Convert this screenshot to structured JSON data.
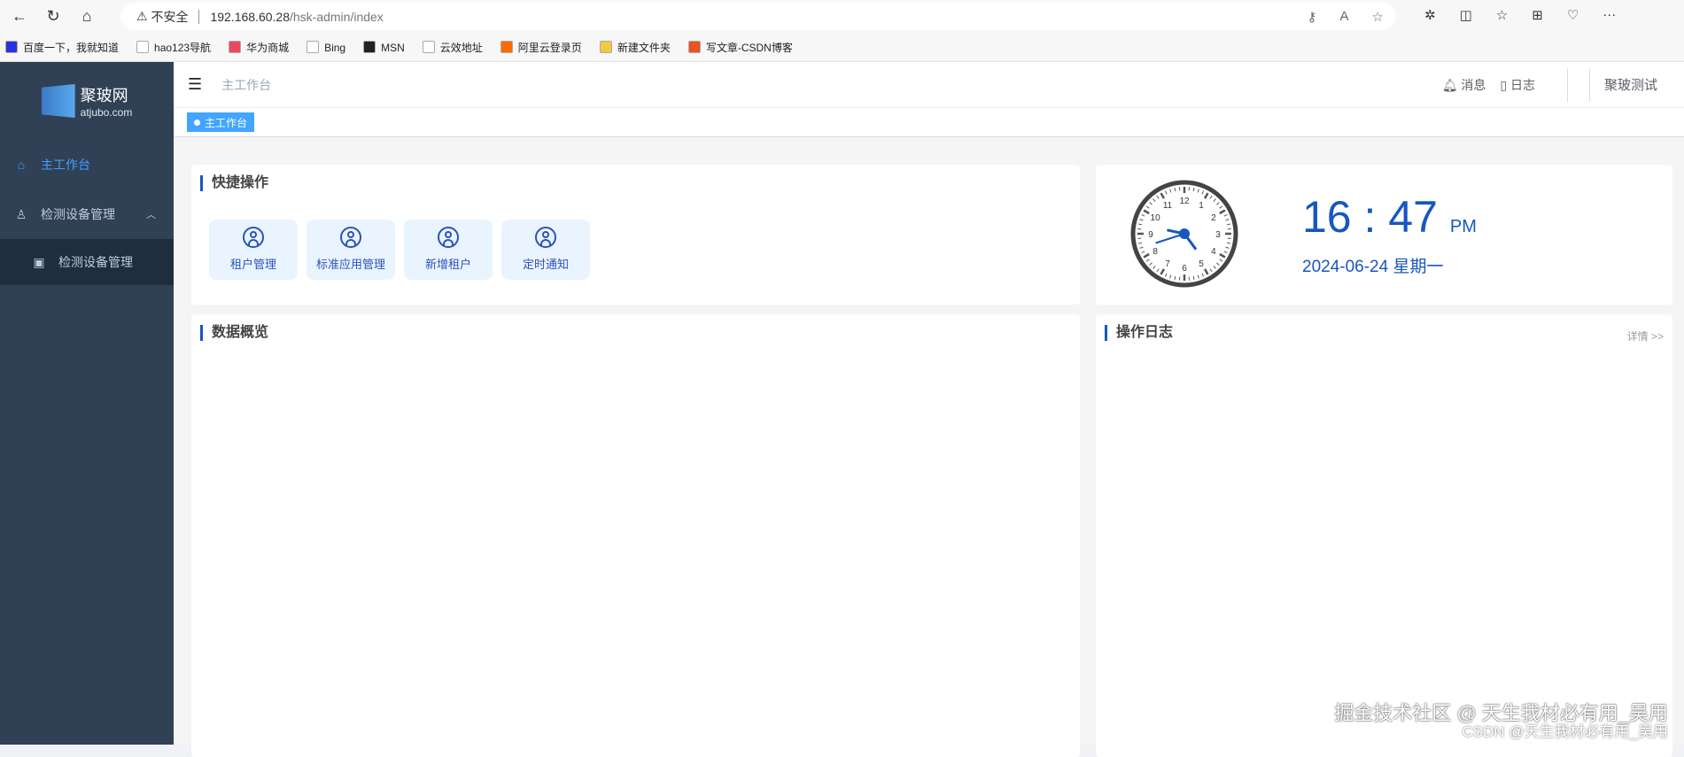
{
  "browser": {
    "security": "不安全",
    "url_host": "192.168.60.28",
    "url_path": "/hsk-admin/index"
  },
  "bookmarks": [
    {
      "label": "百度一下，我就知道",
      "color": "#2932e1"
    },
    {
      "label": "hao123导航",
      "color": "#ffffff"
    },
    {
      "label": "华为商城",
      "color": "#e84a5f"
    },
    {
      "label": "Bing",
      "color": "#ffffff"
    },
    {
      "label": "MSN",
      "color": "#222222"
    },
    {
      "label": "云效地址",
      "color": "#ffffff"
    },
    {
      "label": "阿里云登录页",
      "color": "#ff6a00"
    },
    {
      "label": "新建文件夹",
      "color": "#f5c842"
    },
    {
      "label": "写文章-CSDN博客",
      "color": "#e9541f"
    }
  ],
  "sidebar": {
    "logo_name": "聚玻网",
    "logo_domain": "atjubo.com",
    "items": [
      {
        "label": "主工作台"
      },
      {
        "label": "检测设备管理"
      },
      {
        "label": "检测设备管理"
      }
    ]
  },
  "header": {
    "breadcrumb": "主工作台",
    "messages": "消息",
    "logs": "日志",
    "user": "聚玻测试"
  },
  "tags": {
    "active": "主工作台"
  },
  "quick": {
    "title": "快捷操作",
    "items": [
      "租户管理",
      "标准应用管理",
      "新增租户",
      "定时通知"
    ]
  },
  "clock": {
    "time": "16 : 47",
    "ampm": "PM",
    "date": "2024-06-24 星期一",
    "hour": 16,
    "minute": 47,
    "second": 42
  },
  "overview": {
    "title": "数据概览"
  },
  "oplog": {
    "title": "操作日志",
    "more": "详情 >>"
  },
  "watermark": {
    "line1": "掘金技术社区 @ 天生我材必有用_吴用",
    "line2": "CSDN @天生我材必有用_吴用"
  },
  "accent": "#1657c1"
}
